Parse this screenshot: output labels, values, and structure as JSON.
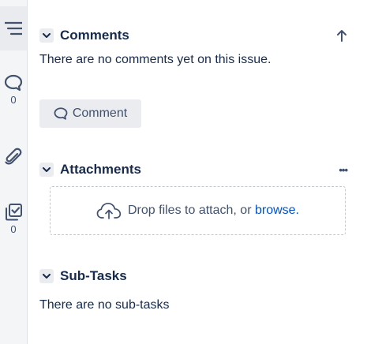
{
  "rail": {
    "items": [
      {
        "icon": "sort-lines-icon",
        "count": ""
      },
      {
        "icon": "comment-icon",
        "count": "0"
      },
      {
        "icon": "paperclip-icon",
        "count": ""
      },
      {
        "icon": "checklist-icon",
        "count": "0"
      }
    ]
  },
  "comments": {
    "title": "Comments",
    "empty_text": "There are no comments yet on this issue.",
    "button_label": "Comment"
  },
  "attachments": {
    "title": "Attachments",
    "more_label": "•••",
    "drop_text": "Drop files to attach, or",
    "browse_label": "browse."
  },
  "subtasks": {
    "title": "Sub-Tasks",
    "empty_text": "There are no sub-tasks"
  },
  "colors": {
    "text": "#172b4d",
    "muted": "#42526e",
    "link": "#0052cc",
    "rail_bg": "#f4f5f7",
    "button_bg": "#ebecf0"
  }
}
